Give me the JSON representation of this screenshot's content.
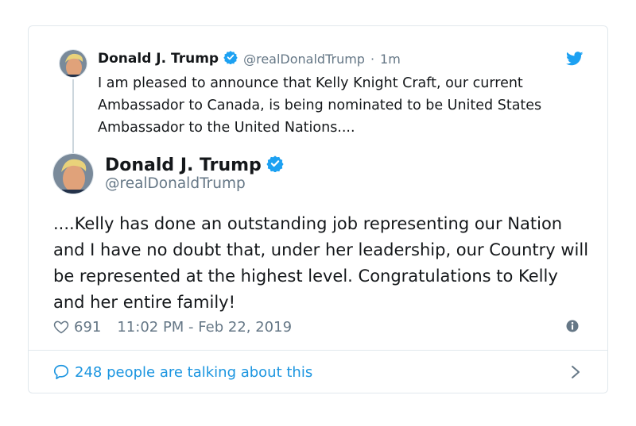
{
  "parent_tweet": {
    "name": "Donald J. Trump",
    "handle": "@realDonaldTrump",
    "separator": "·",
    "time": "1m",
    "text": "I am pleased to announce that Kelly Knight Craft, our current Ambassador to Canada, is being nominated to be United States Ambassador to the United Nations...."
  },
  "main_tweet": {
    "name": "Donald J. Trump",
    "handle": "@realDonaldTrump",
    "text": "....Kelly has done an outstanding job representing our Nation and I have no doubt that, under her leadership, our Country will be represented at the highest level. Congratulations to Kelly and her entire family!",
    "likes": "691",
    "timestamp": "11:02 PM - Feb 22, 2019"
  },
  "footer": {
    "talking": "248 people are talking about this"
  },
  "icons": {
    "verified": "verified-badge-icon",
    "bird": "twitter-bird-icon",
    "heart": "heart-icon",
    "info": "info-icon",
    "bubble": "speech-bubble-icon",
    "chevron": "chevron-right-icon"
  },
  "colors": {
    "accent": "#1da1f2",
    "link": "#1b95e0",
    "muted": "#657786",
    "text": "#14171a",
    "border": "#e1e8ed"
  }
}
